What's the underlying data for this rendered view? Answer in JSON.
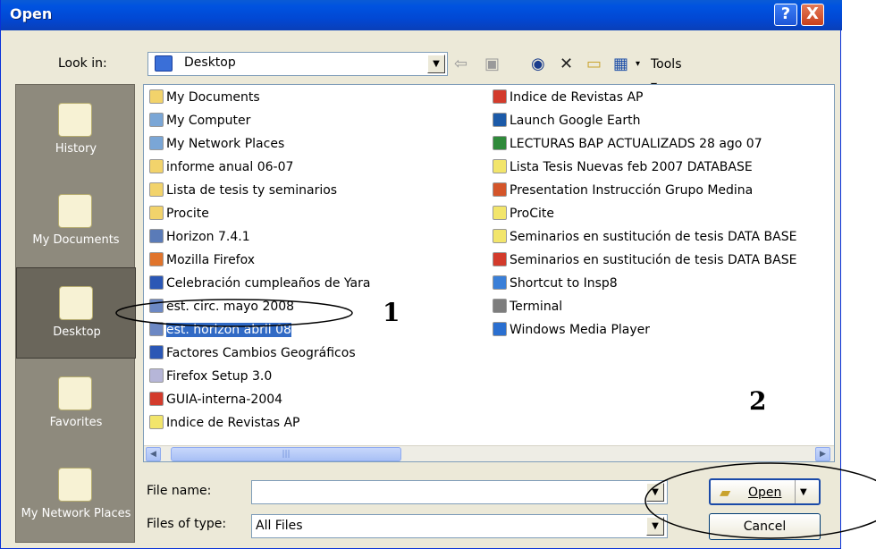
{
  "window": {
    "title": "Open",
    "help_glyph": "?",
    "close_glyph": "X"
  },
  "toolbar": {
    "lookin_label": "Look in:",
    "lookin_value": "Desktop",
    "tools_label": "Tools"
  },
  "places": [
    {
      "label": "History",
      "icon": "history-icon"
    },
    {
      "label": "My Documents",
      "icon": "documents-folder-icon"
    },
    {
      "label": "Desktop",
      "icon": "desktop-icon"
    },
    {
      "label": "Favorites",
      "icon": "favorites-icon"
    },
    {
      "label": "My Network Places",
      "icon": "network-places-icon"
    }
  ],
  "files_col1": [
    {
      "name": "My Documents",
      "icon": "documents-icon",
      "color": "#f2d36b"
    },
    {
      "name": "My Computer",
      "icon": "computer-icon",
      "color": "#7aa6d6"
    },
    {
      "name": "My Network Places",
      "icon": "network-icon",
      "color": "#7aa6d6"
    },
    {
      "name": "informe anual 06-07",
      "icon": "folder-icon",
      "color": "#f2d36b"
    },
    {
      "name": "Lista de tesis ty seminarios",
      "icon": "folder-icon",
      "color": "#f2d36b"
    },
    {
      "name": "Procite",
      "icon": "folder-icon",
      "color": "#f2d36b"
    },
    {
      "name": "Horizon 7.4.1",
      "icon": "shortcut-icon",
      "color": "#5a7bb8"
    },
    {
      "name": "Mozilla Firefox",
      "icon": "firefox-icon",
      "color": "#e0742c"
    },
    {
      "name": "Celebración cumpleaños de Yara",
      "icon": "word-doc-icon",
      "color": "#2b57b5"
    },
    {
      "name": "est. circ. mayo 2008",
      "icon": "data-file-icon",
      "color": "#6c88c4"
    },
    {
      "name": "est. horizon abril 08",
      "icon": "data-file-icon",
      "color": "#6c88c4",
      "selected": true
    },
    {
      "name": "Factores Cambios Geográficos",
      "icon": "word-doc-icon",
      "color": "#2b57b5"
    },
    {
      "name": "Firefox Setup 3.0",
      "icon": "setup-icon",
      "color": "#b6b6d8"
    },
    {
      "name": "GUIA-interna-2004",
      "icon": "pdf-icon",
      "color": "#d33b2c"
    },
    {
      "name": "Indice de Revistas AP",
      "icon": "database-icon",
      "color": "#f2e56b"
    }
  ],
  "files_col2": [
    {
      "name": "Indice de Revistas AP",
      "icon": "database-icon",
      "color": "#d33b2c"
    },
    {
      "name": "Launch Google Earth",
      "icon": "google-earth-icon",
      "color": "#1c5aa8"
    },
    {
      "name": "LECTURAS BAP ACTUALIZADS 28 ago 07",
      "icon": "excel-icon",
      "color": "#2f8a3a"
    },
    {
      "name": "Lista Tesis Nuevas feb 2007 DATABASE",
      "icon": "database-icon",
      "color": "#f2e56b"
    },
    {
      "name": "Presentation Instrucción Grupo Medina",
      "icon": "powerpoint-icon",
      "color": "#d4552a"
    },
    {
      "name": "ProCite",
      "icon": "procite-icon",
      "color": "#f2e56b"
    },
    {
      "name": "Seminarios en sustitución de tesis DATA BASE",
      "icon": "database-icon",
      "color": "#f2e56b"
    },
    {
      "name": "Seminarios en sustitución de tesis DATA BASE",
      "icon": "database-icon",
      "color": "#d33b2c"
    },
    {
      "name": "Shortcut to Insp8",
      "icon": "shortcut-icon",
      "color": "#3a7fd8"
    },
    {
      "name": "Terminal",
      "icon": "terminal-icon",
      "color": "#7d7d7d"
    },
    {
      "name": "Windows Media Player",
      "icon": "media-player-icon",
      "color": "#2a6fd0"
    }
  ],
  "footer": {
    "filename_label": "File name:",
    "filename_value": "",
    "filetype_label": "Files of type:",
    "filetype_value": "All Files",
    "open_label": "Open",
    "cancel_label": "Cancel"
  },
  "annotations": {
    "one": "1",
    "two": "2"
  }
}
